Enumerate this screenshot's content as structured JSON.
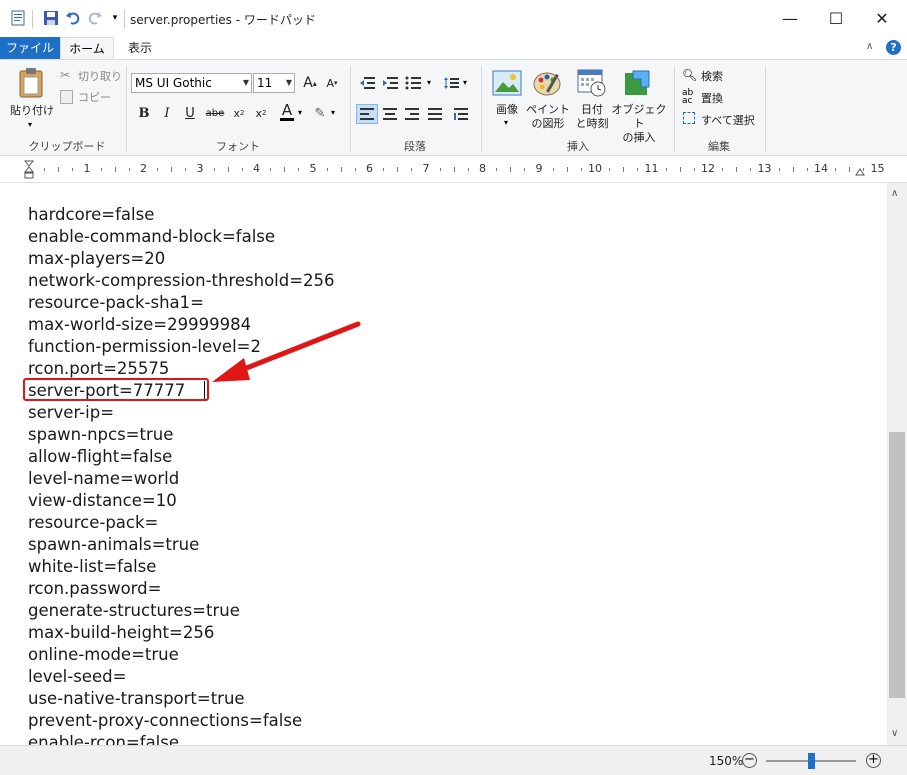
{
  "window": {
    "title": "server.properties - ワードパッド",
    "minimize": "—",
    "maximize": "☐",
    "close": "✕"
  },
  "quick_access": {
    "icons": [
      "wordpad-app-icon",
      "save-icon",
      "undo-icon",
      "redo-icon",
      "customize-dropdown-icon"
    ]
  },
  "tabs": {
    "file": "ファイル",
    "home": "ホーム",
    "view": "表示"
  },
  "ribbon": {
    "clipboard": {
      "paste": "貼り付け",
      "cut": "切り取り",
      "copy": "コピー",
      "group_label": "クリップボード"
    },
    "font": {
      "family": "MS UI Gothic",
      "size": "11",
      "group_label": "フォント"
    },
    "paragraph": {
      "group_label": "段落"
    },
    "insert": {
      "image": "画像",
      "paint_line1": "ペイント",
      "paint_line2": "の図形",
      "datetime_line1": "日付",
      "datetime_line2": "と時刻",
      "object_line1": "オブジェクト",
      "object_line2": "の挿入",
      "group_label": "挿入"
    },
    "edit": {
      "find": "検索",
      "replace": "置換",
      "select_all": "すべて選択",
      "group_label": "編集"
    }
  },
  "ruler": {
    "numbers": [
      "1",
      "2",
      "3",
      "4",
      "5",
      "6",
      "7",
      "8",
      "9",
      "10",
      "11",
      "12",
      "13",
      "14",
      "15"
    ]
  },
  "document": {
    "lines": [
      "hardcore=false",
      "enable-command-block=false",
      "max-players=20",
      "network-compression-threshold=256",
      "resource-pack-sha1=",
      "max-world-size=29999984",
      "function-permission-level=2",
      "rcon.port=25575",
      "server-port=77777",
      "server-ip=",
      "spawn-npcs=true",
      "allow-flight=false",
      "level-name=world",
      "view-distance=10",
      "resource-pack=",
      "spawn-animals=true",
      "white-list=false",
      "rcon.password=",
      "generate-structures=true",
      "max-build-height=256",
      "online-mode=true",
      "level-seed=",
      "use-native-transport=true",
      "prevent-proxy-connections=false",
      "enable-rcon=false"
    ]
  },
  "annotation": {
    "color": "#e01515"
  },
  "statusbar": {
    "zoom": "150%",
    "zoom_out": "−",
    "zoom_in": "+",
    "zoom_level": 0.5
  },
  "colors": {
    "file_tab": "#1e6fc6",
    "ribbon_bg": "#f5f6f7",
    "help": "#1e6fc6"
  }
}
